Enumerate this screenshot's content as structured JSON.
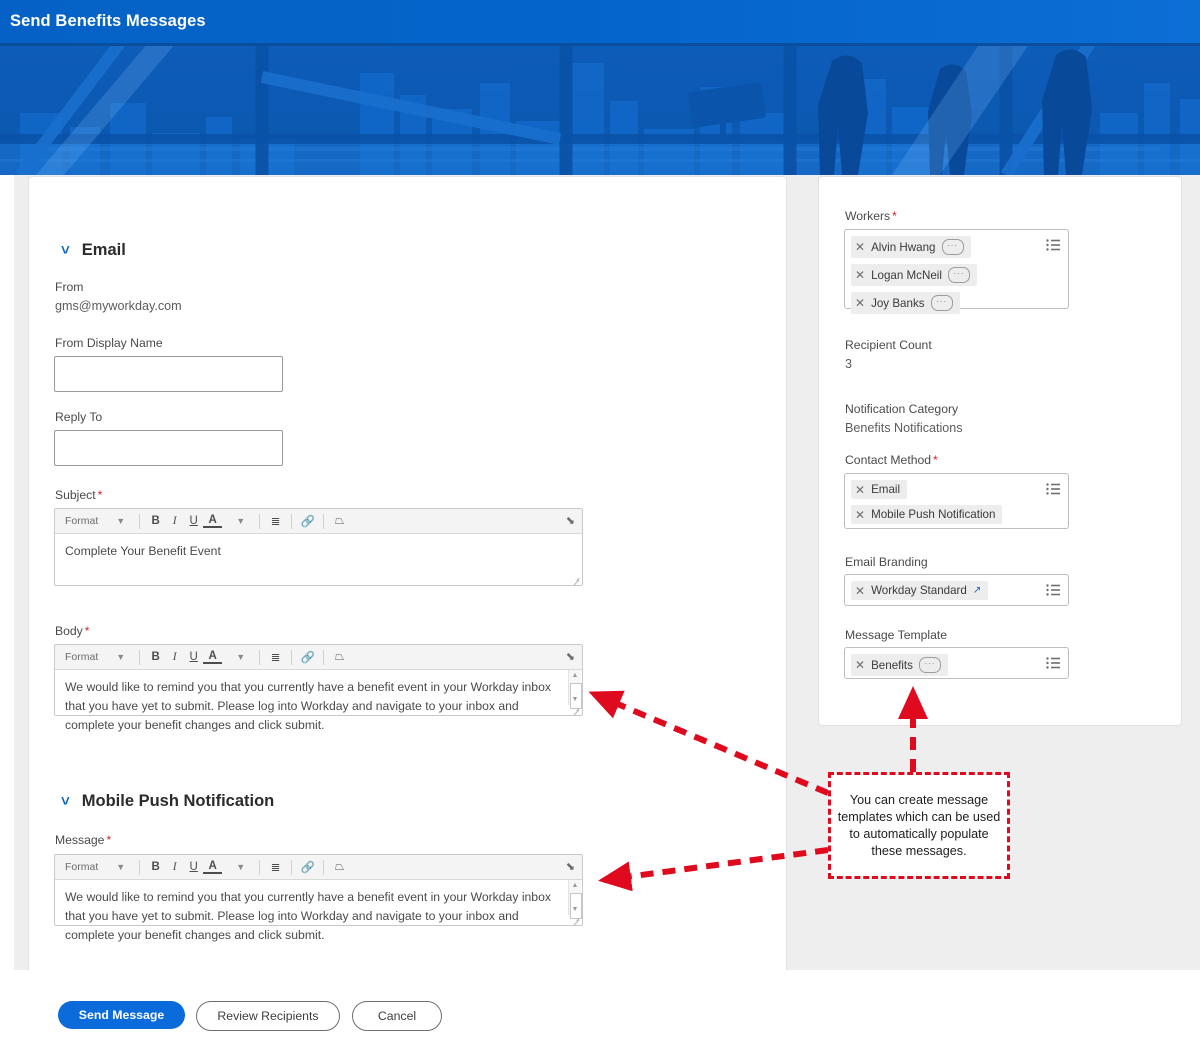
{
  "header": {
    "title": "Send Benefits Messages"
  },
  "email_section": {
    "heading": "Email",
    "chevron": "chevron-down-icon",
    "from_label": "From",
    "from_value": "gms@myworkday.com",
    "from_display_name_label": "From Display Name",
    "from_display_name_value": "",
    "reply_to_label": "Reply To",
    "reply_to_value": "",
    "subject_label": "Subject",
    "subject_required": "*",
    "subject_value": "Complete Your Benefit Event",
    "body_label": "Body",
    "body_required": "*",
    "body_value": "We would like to remind you that you currently have a benefit event in your Workday inbox that you have yet to submit. Please log into Workday and navigate to your inbox and complete your benefit changes and click submit."
  },
  "mobile_section": {
    "heading": "Mobile Push Notification",
    "chevron": "chevron-down-icon",
    "message_label": "Message",
    "message_required": "*",
    "message_value": "We would like to remind you that you currently have a benefit event in your Workday inbox that you have yet to submit. Please log into Workday and navigate to your inbox and complete your benefit changes and click submit."
  },
  "toolbar": {
    "format_label": "Format",
    "format_caret": "chevron-down-icon",
    "bold": "B",
    "italic": "I",
    "underline": "U",
    "font_color": "A",
    "font_color_caret": "chevron-down-icon",
    "bullet_list": "bulleted-list-icon",
    "link": "link-icon",
    "special": "insert-field-icon",
    "expand": "expand-icon"
  },
  "right_panel": {
    "workers_label": "Workers",
    "workers_required": "*",
    "workers": [
      "Alvin Hwang",
      "Logan McNeil",
      "Joy Banks"
    ],
    "recipient_count_label": "Recipient Count",
    "recipient_count_value": "3",
    "notification_category_label": "Notification Category",
    "notification_category_value": "Benefits Notifications",
    "contact_method_label": "Contact Method",
    "contact_method_required": "*",
    "contact_methods": [
      "Email",
      "Mobile Push Notification"
    ],
    "email_branding_label": "Email Branding",
    "email_branding_value": "Workday Standard",
    "message_template_label": "Message Template",
    "message_template_value": "Benefits",
    "prompt_icon": "list-prompt-icon",
    "remove_icon": "close-icon"
  },
  "footer": {
    "send_label": "Send Message",
    "review_label": "Review Recipients",
    "cancel_label": "Cancel"
  },
  "annotation": {
    "text": "You can create message templates which can be used to automatically populate these messages.",
    "color": "#e00a1e"
  },
  "colors": {
    "header_blue": "#0563c8",
    "primary_button": "#0b6bdb",
    "required_red": "#d9202a",
    "annotation_red": "#e00a1e",
    "panel_gray": "#eeeeee",
    "chip_gray": "#ededed"
  }
}
